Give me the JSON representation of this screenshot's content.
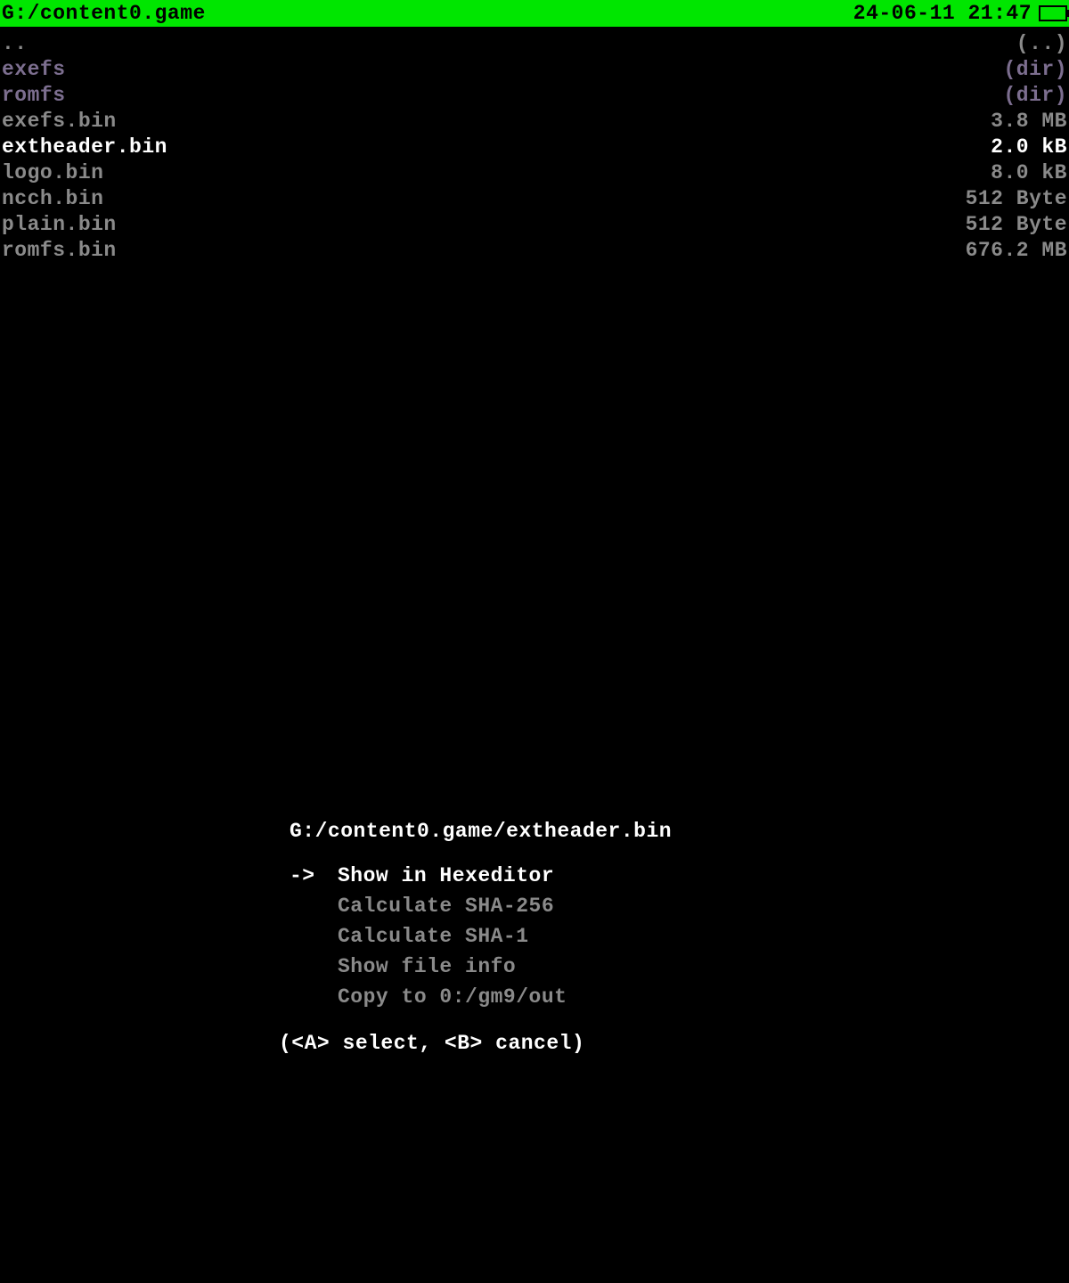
{
  "status_bar": {
    "path": "G:/content0.game",
    "datetime": "24-06-11 21:47"
  },
  "files": [
    {
      "name": "..",
      "size": "(..)",
      "cls": "dim-gray"
    },
    {
      "name": "exefs",
      "size": "(dir)",
      "cls": "dim-purple"
    },
    {
      "name": "romfs",
      "size": "(dir)",
      "cls": "dim-purple"
    },
    {
      "name": "exefs.bin",
      "size": "3.8 MB",
      "cls": "dim-gray"
    },
    {
      "name": "extheader.bin",
      "size": "2.0 kB",
      "cls": "selected"
    },
    {
      "name": "logo.bin",
      "size": "8.0 kB",
      "cls": "dim-gray"
    },
    {
      "name": "ncch.bin",
      "size": "512 Byte",
      "cls": "dim-gray"
    },
    {
      "name": "plain.bin",
      "size": "512 Byte",
      "cls": "dim-gray"
    },
    {
      "name": "romfs.bin",
      "size": "676.2 MB",
      "cls": "dim-gray"
    }
  ],
  "panel": {
    "path": "G:/content0.game/extheader.bin",
    "arrow": "->",
    "items": [
      {
        "label": "Show in Hexeditor",
        "selected": true
      },
      {
        "label": "Calculate SHA-256",
        "selected": false
      },
      {
        "label": "Calculate SHA-1",
        "selected": false
      },
      {
        "label": "Show file info",
        "selected": false
      },
      {
        "label": "Copy to 0:/gm9/out",
        "selected": false
      }
    ],
    "hint": "(<A> select, <B> cancel)"
  }
}
